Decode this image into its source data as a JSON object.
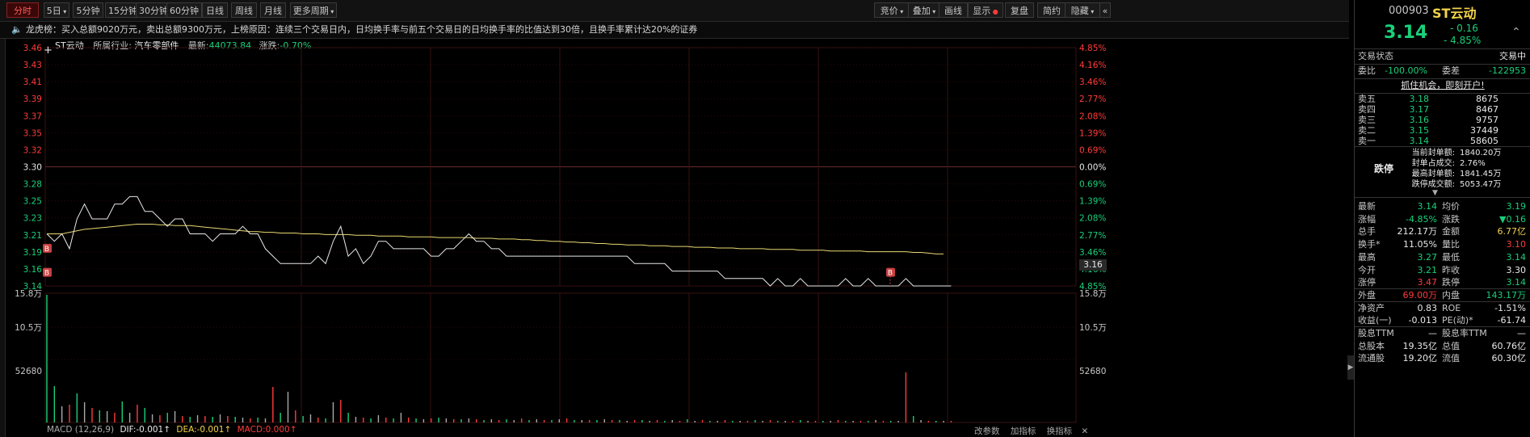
{
  "toolbar": {
    "left_tabs": [
      "分时",
      "5日",
      "5分钟",
      "15分钟",
      "30分钟",
      "60分钟",
      "日线",
      "周线",
      "月线",
      "更多周期"
    ],
    "right_buttons": [
      "竞价",
      "叠加",
      "画线",
      "显示",
      "复盘",
      "简约",
      "隐藏"
    ]
  },
  "notice": {
    "icon": "speaker-icon",
    "text": "龙虎榜：买入总额9020万元，卖出总额9300万元，上榜原因：连续三个交易日内，日均换手率与前五个交易日的日均换手率的比值达到30倍，且换手率累计达20%的证券"
  },
  "infoline": {
    "name": "ST云动",
    "industry_label": "所属行业:",
    "industry": "汽车零部件",
    "latest_label": "最新:",
    "latest": "44073.84",
    "change_label": "涨跌:",
    "change": "-0.70%"
  },
  "axis": {
    "left_prices": [
      "3.46",
      "3.43",
      "3.41",
      "3.39",
      "3.37",
      "3.35",
      "3.32",
      "3.30",
      "3.28",
      "3.25",
      "3.23",
      "3.21",
      "3.19",
      "3.16",
      "3.14"
    ],
    "right_pcts": [
      "4.85%",
      "4.16%",
      "3.46%",
      "2.77%",
      "2.08%",
      "1.39%",
      "0.69%",
      "0.00%",
      "0.69%",
      "1.39%",
      "2.08%",
      "2.77%",
      "3.46%",
      "4.16%",
      "4.85%"
    ],
    "current_price_tag": "3.16",
    "vol_left": [
      "15.8万",
      "10.5万",
      "52680"
    ],
    "vol_right": [
      "15.8万",
      "10.5万",
      "52680"
    ]
  },
  "chart_data": {
    "type": "line",
    "title": "",
    "ylim": [
      3.14,
      3.46
    ],
    "ybase": 3.3,
    "series": [
      {
        "values": [
          3.21,
          3.2,
          3.21,
          3.19,
          3.23,
          3.25,
          3.23,
          3.23,
          3.23,
          3.25,
          3.25,
          3.26,
          3.26,
          3.24,
          3.24,
          3.23,
          3.22,
          3.23,
          3.23,
          3.21,
          3.21,
          3.21,
          3.2,
          3.21,
          3.21,
          3.21,
          3.22,
          3.21,
          3.21,
          3.19,
          3.18,
          3.17,
          3.17,
          3.17,
          3.17,
          3.17,
          3.18,
          3.17,
          3.2,
          3.22,
          3.18,
          3.19,
          3.17,
          3.18,
          3.2,
          3.2,
          3.19,
          3.19,
          3.19,
          3.19,
          3.19,
          3.18,
          3.18,
          3.19,
          3.19,
          3.2,
          3.21,
          3.2,
          3.2,
          3.19,
          3.19,
          3.18,
          3.18,
          3.18,
          3.18,
          3.18,
          3.18,
          3.18,
          3.18,
          3.18,
          3.18,
          3.18,
          3.18,
          3.18,
          3.18,
          3.18,
          3.18,
          3.18,
          3.17,
          3.17,
          3.17,
          3.17,
          3.17,
          3.16,
          3.16,
          3.16,
          3.16,
          3.16,
          3.16,
          3.16,
          3.15,
          3.15,
          3.15,
          3.15,
          3.15,
          3.15,
          3.14,
          3.15,
          3.14,
          3.14,
          3.15,
          3.14,
          3.14,
          3.14,
          3.14,
          3.14,
          3.15,
          3.14,
          3.14,
          3.15,
          3.14,
          3.14,
          3.14,
          3.14,
          3.15,
          3.14,
          3.14,
          3.14,
          3.14,
          3.14,
          3.14
        ]
      },
      {
        "values": [
          3.21,
          3.21,
          3.21,
          3.212,
          3.214,
          3.216,
          3.217,
          3.218,
          3.219,
          3.22,
          3.221,
          3.222,
          3.223,
          3.223,
          3.223,
          3.222,
          3.222,
          3.221,
          3.221,
          3.221,
          3.22,
          3.219,
          3.218,
          3.217,
          3.216,
          3.215,
          3.214,
          3.213,
          3.213,
          3.212,
          3.212,
          3.211,
          3.211,
          3.211,
          3.21,
          3.21,
          3.21,
          3.209,
          3.209,
          3.209,
          3.209,
          3.208,
          3.208,
          3.208,
          3.207,
          3.207,
          3.207,
          3.207,
          3.206,
          3.206,
          3.206,
          3.206,
          3.205,
          3.205,
          3.205,
          3.205,
          3.205,
          3.204,
          3.204,
          3.204,
          3.203,
          3.203,
          3.203,
          3.202,
          3.202,
          3.201,
          3.201,
          3.2,
          3.2,
          3.199,
          3.199,
          3.198,
          3.198,
          3.197,
          3.197,
          3.196,
          3.196,
          3.195,
          3.195,
          3.195,
          3.194,
          3.194,
          3.194,
          3.193,
          3.193,
          3.193,
          3.192,
          3.192,
          3.192,
          3.191,
          3.191,
          3.191,
          3.19,
          3.19,
          3.19,
          3.19,
          3.189,
          3.189,
          3.189,
          3.189,
          3.188,
          3.188,
          3.188,
          3.188,
          3.187,
          3.187,
          3.187,
          3.187,
          3.187,
          3.186,
          3.186,
          3.186,
          3.186,
          3.186,
          3.186,
          3.185,
          3.185,
          3.184,
          3.183,
          3.183
        ]
      }
    ],
    "volume_ylim": [
      0,
      158000
    ],
    "volume": [
      158000,
      45000,
      20000,
      22000,
      36000,
      25000,
      18000,
      15000,
      14000,
      12000,
      26000,
      12000,
      22000,
      18000,
      10000,
      9000,
      12000,
      14000,
      8000,
      7000,
      9000,
      8000,
      7000,
      10000,
      8000,
      7000,
      6000,
      5000,
      6000,
      5000,
      44000,
      12000,
      38000,
      15000,
      8000,
      10000,
      6000,
      5000,
      25000,
      28000,
      12000,
      7000,
      6000,
      5000,
      9000,
      6000,
      5000,
      12000,
      6000,
      5000,
      4000,
      5000,
      6000,
      5000,
      4000,
      4000,
      5000,
      4000,
      3000,
      4000,
      3000,
      4000,
      3000,
      5000,
      3000,
      4000,
      3000,
      3000,
      4000,
      5000,
      3000,
      3000,
      3000,
      3000,
      4000,
      3000,
      3000,
      2000,
      3000,
      3000,
      2000,
      3000,
      2000,
      3000,
      2000,
      4000,
      2000,
      3000,
      2000,
      2000,
      3000,
      2000,
      2000,
      2000,
      3000,
      2000,
      3000,
      2000,
      2000,
      2000,
      3000,
      2000,
      2000,
      2000,
      2000,
      3000,
      2000,
      2000,
      2000,
      2000,
      3000,
      2000,
      2000,
      2000,
      62000,
      8000,
      3000,
      2000,
      2000,
      2000,
      2000
    ],
    "markers": [
      "B",
      "B",
      "B"
    ]
  },
  "indicators": {
    "macd_title": "MACD (12,26,9)",
    "dif": "DIF:-0.001↑",
    "dea": "DEA:-0.001↑",
    "macd": "MACD:0.000↑",
    "bottom_buttons": [
      "改参数",
      "加指标",
      "换指标"
    ]
  },
  "right_panel": {
    "code": "000903",
    "name": "ST云动",
    "price": "3.14",
    "change": "- 0.16",
    "change_pct": "- 4.85%",
    "trade_status_label": "交易状态",
    "trade_status": "交易中",
    "weibi_label": "委比",
    "weibi": "-100.00%",
    "weicha_label": "委差",
    "weicha": "-122953",
    "promo": "抓住机会，即刻开户!",
    "asks": [
      {
        "label": "卖五",
        "price": "3.18",
        "vol": "8675"
      },
      {
        "label": "卖四",
        "price": "3.17",
        "vol": "8467"
      },
      {
        "label": "卖三",
        "price": "3.16",
        "vol": "9757"
      },
      {
        "label": "卖二",
        "price": "3.15",
        "vol": "37449"
      },
      {
        "label": "卖一",
        "price": "3.14",
        "vol": "58605"
      }
    ],
    "limit_label": "跌停",
    "limit_stats": [
      {
        "label": "当前封单额:",
        "value": "1840.20万"
      },
      {
        "label": "封单占成交:",
        "value": "2.76%"
      },
      {
        "label": "最高封单额:",
        "value": "1841.45万"
      },
      {
        "label": "跌停成交额:",
        "value": "5053.47万"
      }
    ],
    "stats": [
      {
        "l1": "最新",
        "v1": "3.14",
        "c1": "green",
        "l2": "均价",
        "v2": "3.19",
        "c2": "green"
      },
      {
        "l1": "涨幅",
        "v1": "-4.85%",
        "c1": "green",
        "l2": "涨跌",
        "v2": "▼0.16",
        "c2": "green"
      },
      {
        "l1": "总手",
        "v1": "212.17万",
        "c1": "white",
        "l2": "金额",
        "v2": "6.77亿",
        "c2": "yellow"
      },
      {
        "l1": "换手*",
        "v1": "11.05%",
        "c1": "white",
        "l2": "量比",
        "v2": "3.10",
        "c2": "red"
      },
      {
        "l1": "最高",
        "v1": "3.27",
        "c1": "green",
        "l2": "最低",
        "v2": "3.14",
        "c2": "green"
      },
      {
        "l1": "今开",
        "v1": "3.21",
        "c1": "green",
        "l2": "昨收",
        "v2": "3.30",
        "c2": "white"
      },
      {
        "l1": "涨停",
        "v1": "3.47",
        "c1": "red",
        "l2": "跌停",
        "v2": "3.14",
        "c2": "green"
      },
      {
        "l1": "外盘",
        "v1": "69.00万",
        "c1": "red",
        "l2": "内盘",
        "v2": "143.17万",
        "c2": "green"
      },
      {
        "l1": "净资产",
        "v1": "0.83",
        "c1": "white",
        "l2": "ROE",
        "v2": "-1.51%",
        "c2": "white"
      },
      {
        "l1": "收益(一)",
        "v1": "-0.013",
        "c1": "white",
        "l2": "PE(动)*",
        "v2": "-61.74",
        "c2": "white"
      },
      {
        "l1": "股息TTM",
        "v1": "—",
        "c1": "white",
        "l2": "股息率TTM",
        "v2": "—",
        "c2": "white"
      },
      {
        "l1": "总股本",
        "v1": "19.35亿",
        "c1": "white",
        "l2": "总值",
        "v2": "60.76亿",
        "c2": "white"
      },
      {
        "l1": "流通股",
        "v1": "19.20亿",
        "c1": "white",
        "l2": "流值",
        "v2": "60.30亿",
        "c2": "white"
      }
    ]
  },
  "colors": {
    "up": "#ff3b3b",
    "down": "#19d07a",
    "avg": "#e8d870",
    "price_line": "#e8e8e8",
    "grid": "#3a1010"
  }
}
